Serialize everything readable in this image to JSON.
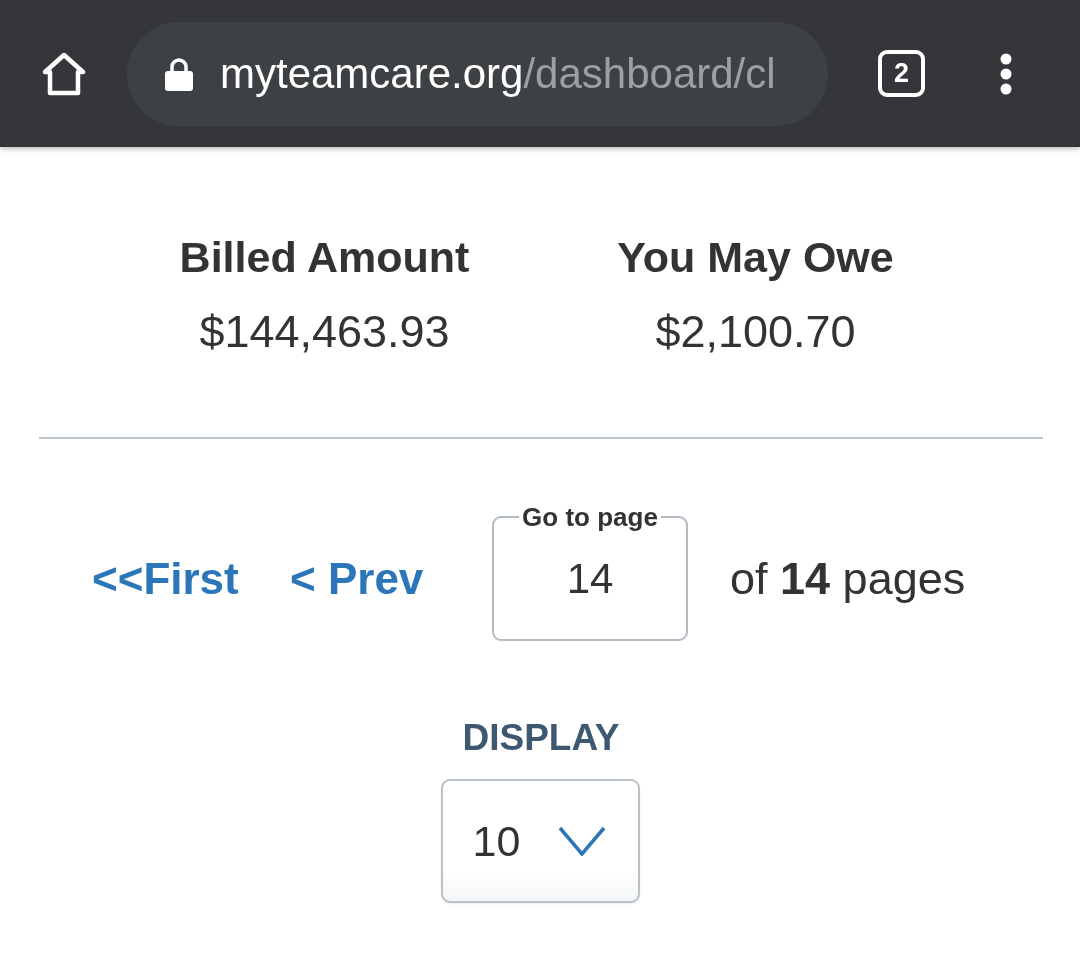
{
  "browser_bar": {
    "url": {
      "host": "myteamcare.org",
      "path": "/dashboard/cl"
    },
    "tab_count": "2"
  },
  "summary": [
    {
      "label": "Billed Amount",
      "value": "$144,463.93"
    },
    {
      "label": "You May Owe",
      "value": "$2,100.70"
    }
  ],
  "pagination": {
    "first": "<<First",
    "prev": "< Prev",
    "page_field": {
      "label": "Go to page",
      "value": "14"
    },
    "page_count": "of **14** pages"
  },
  "display": {
    "label": "DISPLAY",
    "value": "10"
  }
}
